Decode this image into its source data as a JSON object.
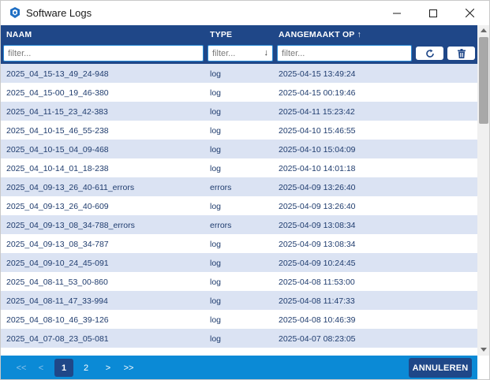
{
  "window": {
    "title": "Software Logs",
    "accent": "#1f4788",
    "footer_color": "#0b8ad6",
    "row_alt_color": "#dbe3f3"
  },
  "columns": {
    "naam": "NAAM",
    "type": "TYPE",
    "aangemaakt": "AANGEMAAKT OP ↑"
  },
  "filters": {
    "naam_placeholder": "filter...",
    "type_placeholder": "filter...",
    "aangemaakt_placeholder": "filter...",
    "refresh_icon": "refresh-icon",
    "delete_icon": "trash-icon"
  },
  "rows": [
    {
      "name": "2025_04_15-13_49_24-948",
      "type": "log",
      "created": "2025-04-15 13:49:24"
    },
    {
      "name": "2025_04_15-00_19_46-380",
      "type": "log",
      "created": "2025-04-15 00:19:46"
    },
    {
      "name": "2025_04_11-15_23_42-383",
      "type": "log",
      "created": "2025-04-11 15:23:42"
    },
    {
      "name": "2025_04_10-15_46_55-238",
      "type": "log",
      "created": "2025-04-10 15:46:55"
    },
    {
      "name": "2025_04_10-15_04_09-468",
      "type": "log",
      "created": "2025-04-10 15:04:09"
    },
    {
      "name": "2025_04_10-14_01_18-238",
      "type": "log",
      "created": "2025-04-10 14:01:18"
    },
    {
      "name": "2025_04_09-13_26_40-611_errors",
      "type": "errors",
      "created": "2025-04-09 13:26:40"
    },
    {
      "name": "2025_04_09-13_26_40-609",
      "type": "log",
      "created": "2025-04-09 13:26:40"
    },
    {
      "name": "2025_04_09-13_08_34-788_errors",
      "type": "errors",
      "created": "2025-04-09 13:08:34"
    },
    {
      "name": "2025_04_09-13_08_34-787",
      "type": "log",
      "created": "2025-04-09 13:08:34"
    },
    {
      "name": "2025_04_09-10_24_45-091",
      "type": "log",
      "created": "2025-04-09 10:24:45"
    },
    {
      "name": "2025_04_08-11_53_00-860",
      "type": "log",
      "created": "2025-04-08 11:53:00"
    },
    {
      "name": "2025_04_08-11_47_33-994",
      "type": "log",
      "created": "2025-04-08 11:47:33"
    },
    {
      "name": "2025_04_08-10_46_39-126",
      "type": "log",
      "created": "2025-04-08 10:46:39"
    },
    {
      "name": "2025_04_07-08_23_05-081",
      "type": "log",
      "created": "2025-04-07 08:23:05"
    }
  ],
  "pagination": {
    "first": "<<",
    "prev": "<",
    "page1": "1",
    "page2": "2",
    "next": ">",
    "last": ">>",
    "current": 1
  },
  "cancel_label": "ANNULEREN"
}
